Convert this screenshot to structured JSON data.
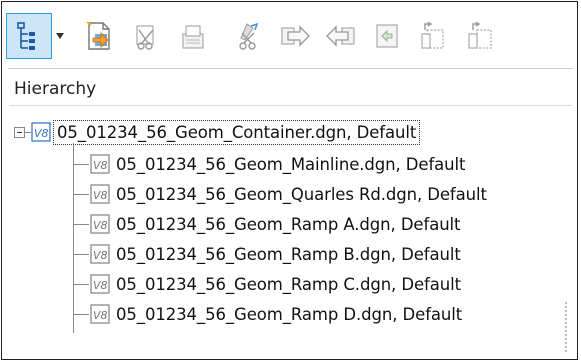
{
  "panel": {
    "header": "Hierarchy"
  },
  "toolbar": {
    "buttons": [
      {
        "name": "hierarchy-view-icon",
        "active": true
      },
      {
        "name": "dropdown-arrow-icon"
      },
      {
        "name": "open-reference-icon"
      },
      {
        "name": "detach-icon"
      },
      {
        "name": "reload-icon"
      },
      {
        "name": "cut-tool-icon"
      },
      {
        "name": "move-arrow-right-icon"
      },
      {
        "name": "move-arrow-left-icon"
      },
      {
        "name": "copy-icon"
      },
      {
        "name": "export-icon"
      },
      {
        "name": "import-icon"
      }
    ]
  },
  "tree": {
    "root": {
      "icon": "v8-file-icon",
      "label": "05_01234_56_Geom_Container.dgn, Default",
      "expanded": true
    },
    "children": [
      {
        "label": "05_01234_56_Geom_Mainline.dgn, Default"
      },
      {
        "label": "05_01234_56_Geom_Quarles Rd.dgn, Default"
      },
      {
        "label": "05_01234_56_Geom_Ramp A.dgn, Default"
      },
      {
        "label": "05_01234_56_Geom_Ramp B.dgn, Default"
      },
      {
        "label": "05_01234_56_Geom_Ramp C.dgn, Default"
      },
      {
        "label": "05_01234_56_Geom_Ramp D.dgn, Default"
      }
    ]
  },
  "colors": {
    "accent": "#26a0da",
    "active_bg": "#cde6f7",
    "icon_blue": "#3b78c2",
    "icon_gray": "#8a8a8a"
  }
}
